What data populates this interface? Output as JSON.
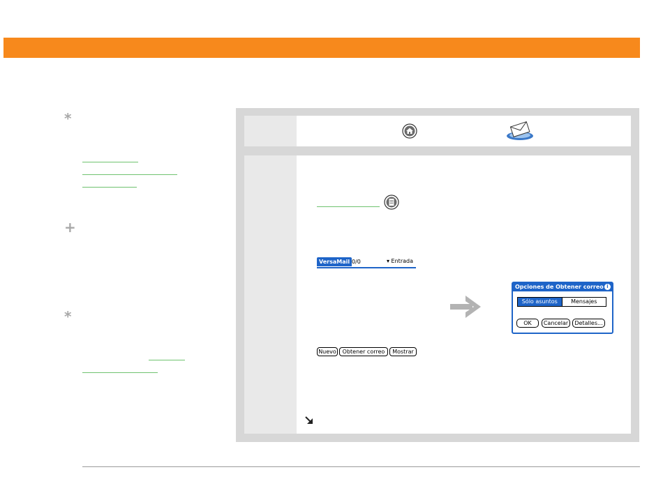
{
  "icons": {
    "tip1": "asterisk-icon",
    "plus": "plus-icon",
    "tip2": "asterisk-icon",
    "home": "home-icon",
    "mail": "mail-icon",
    "menu": "menu-icon",
    "arrow": "right-arrow-icon",
    "continue": "continue-arrow-icon",
    "info": "info-icon"
  },
  "sidebar": {
    "tip1_symbol": "*",
    "plus_symbol": "+",
    "tip2_symbol": "*"
  },
  "versamail_bar": {
    "app_name": "VersaMail",
    "count": "0/0",
    "folder": "▾ Entrada"
  },
  "dialog": {
    "title": "Opciones de Obtener correo",
    "info_glyph": "i",
    "segment_selected": "Sólo asuntos",
    "segment_other": "Mensajes",
    "ok": "OK",
    "cancel": "Cancelar",
    "details": "Detalles..."
  },
  "palm_buttons": {
    "new": "Nuevo",
    "get_mail": "Obtener correo",
    "show": "Mostrar"
  },
  "colors": {
    "banner": "#f7891c",
    "palm_blue": "#1e64c8",
    "link_green": "#6fc26f"
  }
}
